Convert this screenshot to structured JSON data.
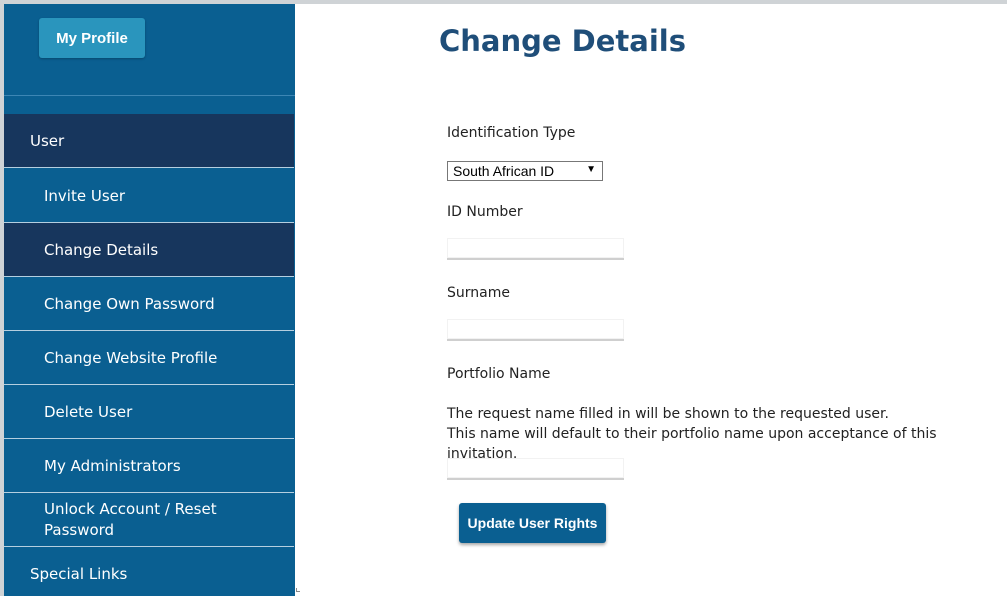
{
  "sidebar": {
    "profile_button": "My Profile",
    "items": [
      {
        "label": "User"
      },
      {
        "label": "Invite User"
      },
      {
        "label": "Change Details"
      },
      {
        "label": "Change Own Password"
      },
      {
        "label": "Change Website Profile"
      },
      {
        "label": "Delete User"
      },
      {
        "label": "My Administrators"
      },
      {
        "label_line1": "Unlock Account / Reset",
        "label_line2": "Password"
      },
      {
        "label": "Special Links"
      }
    ],
    "active_item": "Change Details"
  },
  "main": {
    "title": "Change Details",
    "identification_type_label": "Identification Type",
    "identification_type_value": "South African ID",
    "id_number_label": "ID Number",
    "id_number_value": "",
    "surname_label": "Surname",
    "surname_value": "",
    "portfolio_name_label": "Portfolio Name",
    "note_line1": "The request name filled in will be shown to the requested user.",
    "note_line2": "This name will default to their portfolio name upon acceptance of this invitation.",
    "portfolio_name_value": "",
    "submit_label": "Update User Rights"
  },
  "colors": {
    "sidebar_bg": "#0a5f91",
    "sidebar_active_bg": "#17365d",
    "title": "#1f4e79",
    "profile_button_bg": "#2a95bd"
  }
}
